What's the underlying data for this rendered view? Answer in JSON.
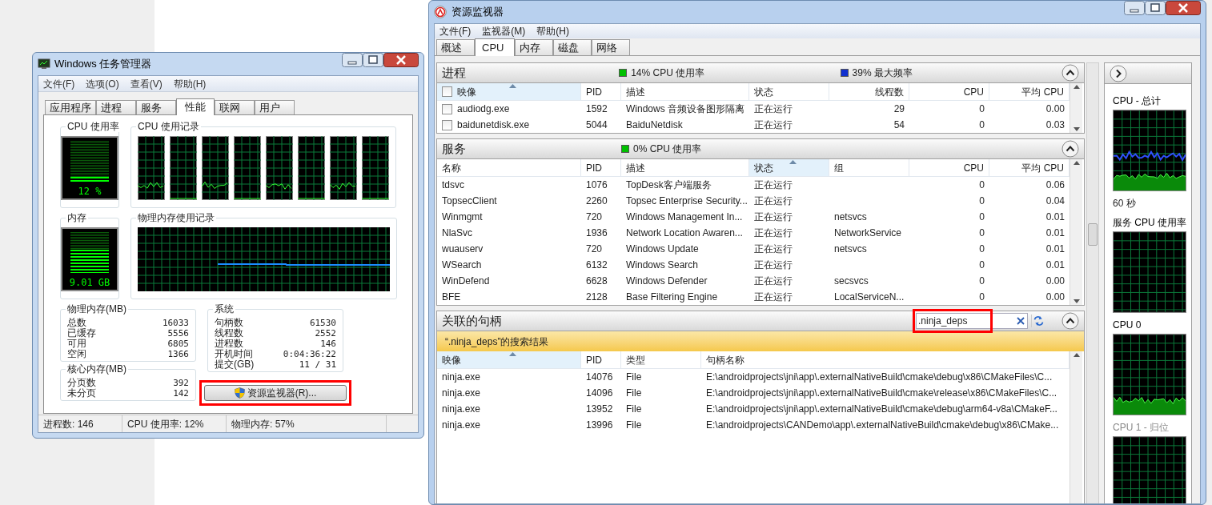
{
  "task_manager": {
    "title": "Windows 任务管理器",
    "menu": [
      "文件(F)",
      "选项(O)",
      "查看(V)",
      "帮助(H)"
    ],
    "tabs": [
      {
        "label": "应用程序",
        "selected": false
      },
      {
        "label": "进程",
        "selected": false
      },
      {
        "label": "服务",
        "selected": false
      },
      {
        "label": "性能",
        "selected": true
      },
      {
        "label": "联网",
        "selected": false
      },
      {
        "label": "用户",
        "selected": false
      }
    ],
    "cpu_usage": {
      "label": "CPU 使用率",
      "reading": "12 %",
      "level": 0.12
    },
    "cpu_history": {
      "label": "CPU 使用记录"
    },
    "memory": {
      "label": "内存",
      "reading": "9.01 GB",
      "level": 0.57
    },
    "memory_history": {
      "label": "物理内存使用记录"
    },
    "stat_groups": [
      {
        "title": "物理内存(MB)",
        "rows": [
          [
            "总数",
            "16033"
          ],
          [
            "已缓存",
            "5556"
          ],
          [
            "可用",
            "6805"
          ],
          [
            "空闲",
            "1366"
          ]
        ]
      },
      {
        "title": "核心内存(MB)",
        "rows": [
          [
            "分页数",
            "392"
          ],
          [
            "未分页",
            "142"
          ]
        ]
      },
      {
        "title": "系统",
        "rows": [
          [
            "句柄数",
            "61530"
          ],
          [
            "线程数",
            "2552"
          ],
          [
            "进程数",
            "146"
          ],
          [
            "开机时间",
            "0:04:36:22"
          ],
          [
            "提交(GB)",
            "11 / 31"
          ]
        ]
      }
    ],
    "button": {
      "label": "资源监视器(R)...",
      "highlighted": true
    },
    "status_bar": [
      "进程数: 146",
      "CPU 使用率: 12%",
      "物理内存: 57%"
    ]
  },
  "resource_monitor": {
    "title": "资源监视器",
    "menu": [
      "文件(F)",
      "监视器(M)",
      "帮助(H)"
    ],
    "tabs": [
      {
        "label": "概述",
        "selected": false
      },
      {
        "label": "CPU",
        "selected": true
      },
      {
        "label": "内存",
        "selected": false
      },
      {
        "label": "磁盘",
        "selected": false
      },
      {
        "label": "网络",
        "selected": false
      }
    ],
    "processes": {
      "title": "进程",
      "indicators": [
        {
          "text": "14% CPU 使用率",
          "color": "#00c000"
        },
        {
          "text": "39% 最大频率",
          "color": "#1030d0"
        }
      ],
      "select_all_checked": false,
      "columns": [
        {
          "label": "映像",
          "sorted": true
        },
        {
          "label": "PID",
          "sorted": false
        },
        {
          "label": "描述",
          "sorted": false
        },
        {
          "label": "状态",
          "sorted": false
        },
        {
          "label": "线程数",
          "sorted": false
        },
        {
          "label": "CPU",
          "sorted": false
        },
        {
          "label": "平均 CPU",
          "sorted": false
        }
      ],
      "rows": [
        {
          "checked": false,
          "cells": [
            "audiodg.exe",
            "1592",
            "Windows 音频设备图形隔离",
            "正在运行",
            "29",
            "0",
            "0.00"
          ]
        },
        {
          "checked": false,
          "cells": [
            "baidunetdisk.exe",
            "5044",
            "BaiduNetdisk",
            "正在运行",
            "54",
            "0",
            "0.03"
          ]
        }
      ]
    },
    "services": {
      "title": "服务",
      "indicators": [
        {
          "text": "0% CPU 使用率",
          "color": "#00c000"
        }
      ],
      "columns": [
        {
          "label": "名称",
          "sorted": false
        },
        {
          "label": "PID",
          "sorted": false
        },
        {
          "label": "描述",
          "sorted": false
        },
        {
          "label": "状态",
          "sorted": true
        },
        {
          "label": "组",
          "sorted": false
        },
        {
          "label": "CPU",
          "sorted": false
        },
        {
          "label": "平均 CPU",
          "sorted": false
        }
      ],
      "rows": [
        [
          "tdsvc",
          "1076",
          "TopDesk客户端服务",
          "正在运行",
          "",
          "0",
          "0.06"
        ],
        [
          "TopsecClient",
          "2260",
          "Topsec Enterprise Security...",
          "正在运行",
          "",
          "0",
          "0.04"
        ],
        [
          "Winmgmt",
          "720",
          "Windows Management In...",
          "正在运行",
          "netsvcs",
          "0",
          "0.01"
        ],
        [
          "NlaSvc",
          "1936",
          "Network Location Awaren...",
          "正在运行",
          "NetworkService",
          "0",
          "0.01"
        ],
        [
          "wuauserv",
          "720",
          "Windows Update",
          "正在运行",
          "netsvcs",
          "0",
          "0.01"
        ],
        [
          "WSearch",
          "6132",
          "Windows Search",
          "正在运行",
          "",
          "0",
          "0.01"
        ],
        [
          "WinDefend",
          "6628",
          "Windows Defender",
          "正在运行",
          "secsvcs",
          "0",
          "0.00"
        ],
        [
          "BFE",
          "2128",
          "Base Filtering Engine",
          "正在运行",
          "LocalServiceN...",
          "0",
          "0.00"
        ]
      ]
    },
    "handles": {
      "title": "关联的句柄",
      "search": {
        "value": ".ninja_deps",
        "highlighted": true
      },
      "banner": "“.ninja_deps”的搜索结果",
      "columns": [
        {
          "label": "映像",
          "sorted": true
        },
        {
          "label": "PID",
          "sorted": false
        },
        {
          "label": "类型",
          "sorted": false
        },
        {
          "label": "句柄名称",
          "sorted": false
        }
      ],
      "rows": [
        [
          "ninja.exe",
          "14076",
          "File",
          "E:\\androidprojects\\jni\\app\\.externalNativeBuild\\cmake\\debug\\x86\\CMakeFiles\\C..."
        ],
        [
          "ninja.exe",
          "14096",
          "File",
          "E:\\androidprojects\\jni\\app\\.externalNativeBuild\\cmake\\release\\x86\\CMakeFiles\\C..."
        ],
        [
          "ninja.exe",
          "13952",
          "File",
          "E:\\androidprojects\\jni\\app\\.externalNativeBuild\\cmake\\debug\\arm64-v8a\\CMakeF..."
        ],
        [
          "ninja.exe",
          "13996",
          "File",
          "E:\\androidprojects\\CANDemo\\app\\.externalNativeBuild\\cmake\\debug\\x86\\CMake..."
        ]
      ]
    },
    "graphs": [
      {
        "label": "CPU - 总计",
        "caption": "60 秒",
        "disabled": false
      },
      {
        "label": "服务 CPU 使用率",
        "disabled": false
      },
      {
        "label": "CPU 0",
        "disabled": false
      },
      {
        "label": "CPU 1 - 归位",
        "disabled": true
      }
    ]
  }
}
